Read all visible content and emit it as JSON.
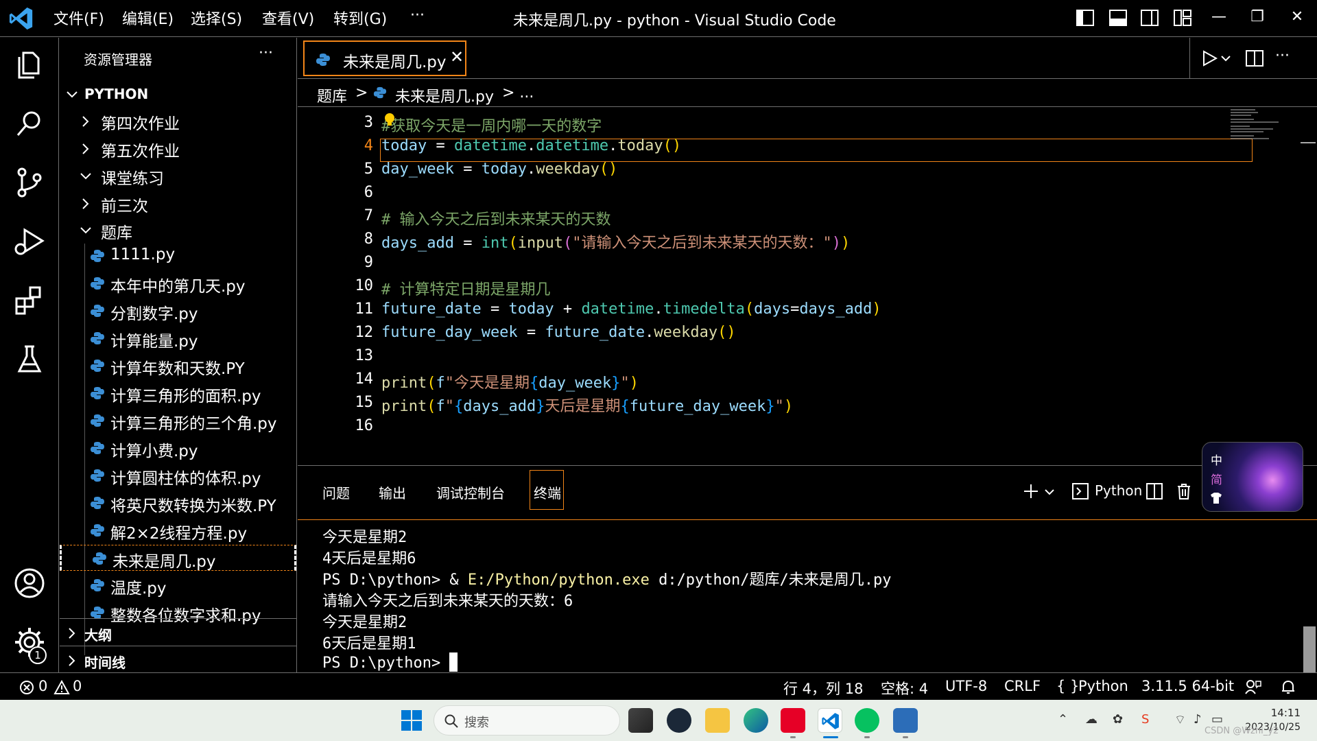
{
  "titlebar": {
    "menus": [
      "文件(F)",
      "编辑(E)",
      "选择(S)",
      "查看(V)",
      "转到(G)",
      "···"
    ],
    "title": "未来是周几.py - python - Visual Studio Code",
    "controls": [
      "—",
      "❐",
      "✕"
    ]
  },
  "activity": {
    "badge": "1"
  },
  "sidebar": {
    "title": "资源管理器",
    "more": "···",
    "root": "PYTHON",
    "folders": [
      "第四次作业",
      "第五次作业",
      "课堂练习",
      "前三次",
      "题库"
    ],
    "files": [
      "1111.py",
      "本年中的第几天.py",
      "分割数字.py",
      "计算能量.py",
      "计算年数和天数.PY",
      "计算三角形的面积.py",
      "计算三角形的三个角.py",
      "计算小费.py",
      "计算圆柱体的体积.py",
      "将英尺数转换为米数.PY",
      "解2×2线程方程.py",
      "未来是周几.py",
      "温度.py",
      "整数各位数字求和.py"
    ],
    "outline": "大纲",
    "timeline": "时间线"
  },
  "editor": {
    "tab_label": "未来是周几.py",
    "tab_close": "✕",
    "breadcrumb": [
      "题库",
      ">",
      "未来是周几.py",
      "> ..."
    ],
    "line_numbers": [
      "3",
      "4",
      "5",
      "6",
      "7",
      "8",
      "9",
      "10",
      "11",
      "12",
      "13",
      "14",
      "15",
      "16"
    ],
    "lines": {
      "l3": "获取今天是一周内哪一天的数字",
      "l3_hash": "#",
      "l4_var": "today",
      "l4_eq": " = ",
      "l4_mod": "datetime",
      "l4_dot1": ".",
      "l4_cls": "datetime",
      "l4_dot2": ".",
      "l4_fn": "today",
      "l4_paren": "()",
      "l5_var": "day_week",
      "l5_eq": " = ",
      "l5_obj": "today",
      "l5_dot": ".",
      "l5_fn": "weekday",
      "l5_paren": "()",
      "l7": "# 输入今天之后到未来某天的天数",
      "l8_var": "days_add",
      "l8_eq": " = ",
      "l8_int": "int",
      "l8_p1": "(",
      "l8_input": "input",
      "l8_p2": "(",
      "l8_str": "\"请输入今天之后到未来某天的天数：\"",
      "l8_p3": ")",
      "l8_p4": ")",
      "l10": "# 计算特定日期是星期几",
      "l11_var": "future_date",
      "l11_eq": " = ",
      "l11_today": "today",
      "l11_plus": " + ",
      "l11_mod": "datetime",
      "l11_dot": ".",
      "l11_cls": "timedelta",
      "l11_p1": "(",
      "l11_arg": "days",
      "l11_eq2": "=",
      "l11_val": "days_add",
      "l11_p2": ")",
      "l12_var": "future_day_week",
      "l12_eq": " = ",
      "l12_obj": "future_date",
      "l12_dot": ".",
      "l12_fn": "weekday",
      "l12_paren": "()",
      "l14_fn": "print",
      "l14_p1": "(",
      "l14_f": "f",
      "l14_s1": "\"今天是星期",
      "l14_b1": "{",
      "l14_v": "day_week",
      "l14_b2": "}",
      "l14_s2": "\"",
      "l14_p2": ")",
      "l15_fn": "print",
      "l15_p1": "(",
      "l15_f": "f",
      "l15_s1": "\"",
      "l15_b1": "{",
      "l15_v1": "days_add",
      "l15_b2": "}",
      "l15_s2": "天后是星期",
      "l15_b3": "{",
      "l15_v2": "future_day_week",
      "l15_b4": "}",
      "l15_s3": "\"",
      "l15_p2": ")"
    }
  },
  "panel": {
    "tabs": [
      "问题",
      "输出",
      "调试控制台",
      "终端"
    ],
    "terminal_name": "Python",
    "terminal": [
      "今天是星期2",
      "4天后是星期6",
      "PS D:\\python> & ",
      "E:/Python/python.exe",
      " d:/python/题库/未来是周几.py",
      "请输入今天之后到未来某天的天数：6",
      "今天是星期2",
      "6天后是星期1",
      "PS D:\\python> "
    ]
  },
  "ime": {
    "zh": "中",
    "jian": "简"
  },
  "statusbar": {
    "errors": "0",
    "warnings": "0",
    "position": "行 4，列 18",
    "spaces": "空格: 4",
    "encoding": "UTF-8",
    "eol": "CRLF",
    "language": "Python",
    "interpreter": "3.11.5 64-bit"
  },
  "taskbar": {
    "search_placeholder": "搜索",
    "time": "14:11",
    "date": "2023/10/25",
    "watermark": "CSDN @Wzhi_y2"
  },
  "colors": {
    "accent_orange": "#f38518",
    "border_gray": "#6f6f6f",
    "vscode_blue": "#0078d4",
    "taskbar_bg": "#e9efe9"
  }
}
